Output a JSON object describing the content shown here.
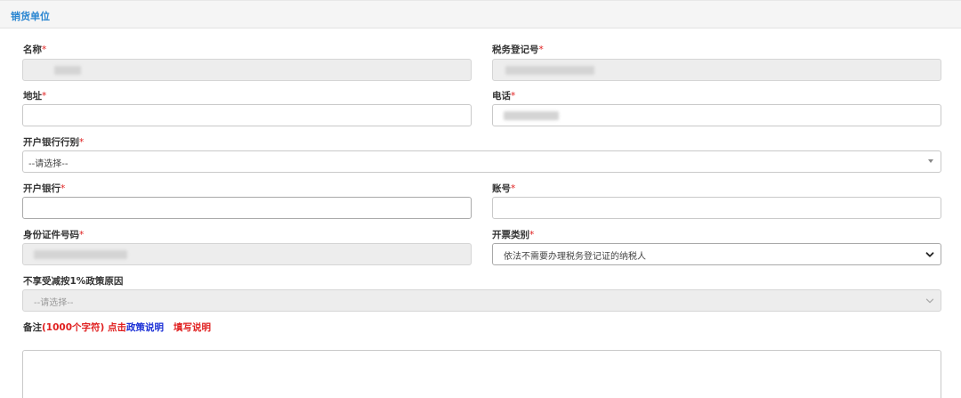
{
  "section": {
    "title": "销货单位"
  },
  "required_mark": "*",
  "fields": {
    "name": {
      "label": "名称"
    },
    "tax_id": {
      "label": "税务登记号"
    },
    "address": {
      "label": "地址"
    },
    "phone": {
      "label": "电话"
    },
    "bank_category": {
      "label": "开户银行行别",
      "selected": "--请选择--"
    },
    "bank": {
      "label": "开户银行"
    },
    "account": {
      "label": "账号"
    },
    "id_number": {
      "label": "身份证件号码"
    },
    "invoice_type": {
      "label": "开票类别",
      "selected": "依法不需要办理税务登记证的纳税人"
    },
    "exempt_reason": {
      "label": "不享受减按1%政策原因",
      "selected": "--请选择--"
    }
  },
  "remarks": {
    "label": "备注",
    "limit": "(1000个字符)",
    "click": "点击",
    "policy_link": "政策说明",
    "fill_link": "填写说明"
  }
}
